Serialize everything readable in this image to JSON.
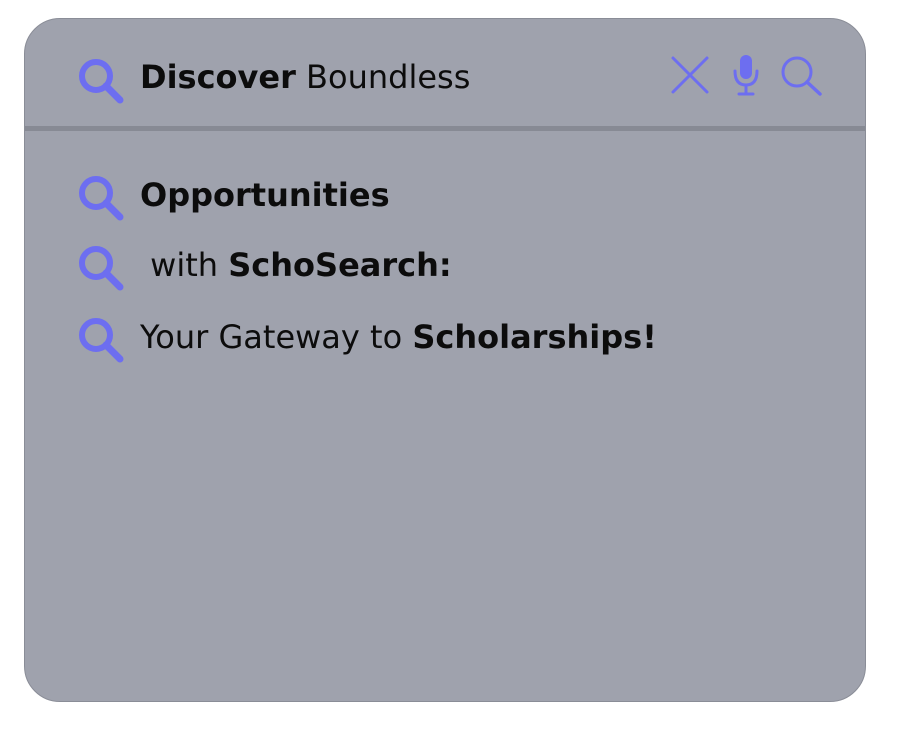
{
  "search": {
    "query_bold": "Discover",
    "query_rest": " Boundless",
    "clear_icon": "close-icon",
    "mic_icon": "microphone-icon",
    "search_icon": "search-icon"
  },
  "suggestions": [
    {
      "pre": "",
      "bold": "Opportunities",
      "post": ""
    },
    {
      "pre": " with ",
      "bold": "SchoSearch:",
      "post": ""
    },
    {
      "pre": "Your Gateway to ",
      "bold": "Scholarships!",
      "post": ""
    }
  ],
  "colors": {
    "accent": "#6d6ef0",
    "panel": "#9fa2ad",
    "divider": "#878a94",
    "text": "#0c0c0c"
  }
}
